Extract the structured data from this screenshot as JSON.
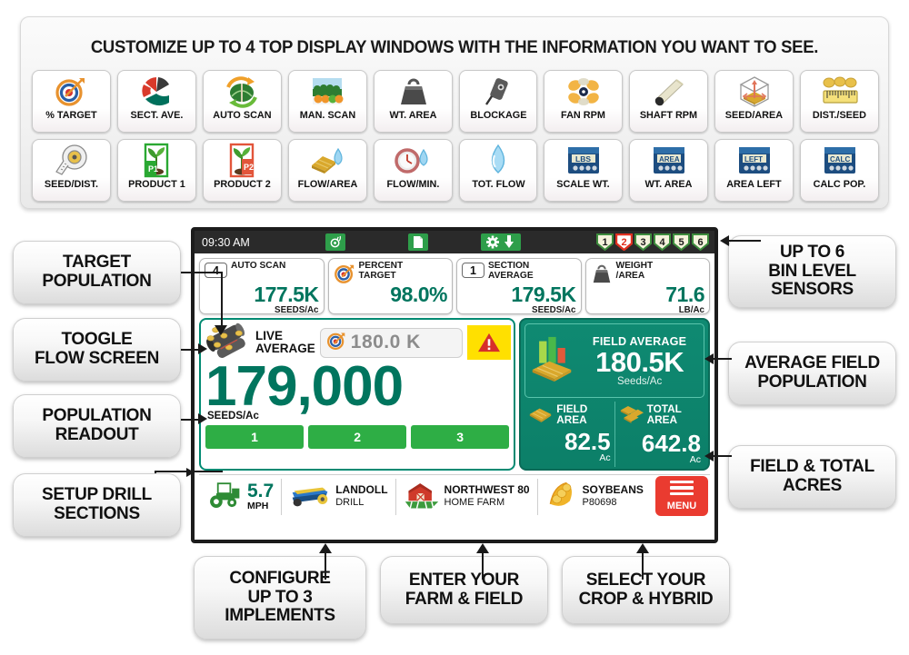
{
  "banner": {
    "title": "CUSTOMIZE UP TO 4 TOP DISPLAY WINDOWS WITH THE INFORMATION YOU WANT TO SEE."
  },
  "icon_grid": {
    "row1": [
      {
        "label": "% TARGET",
        "icon": "target-icon"
      },
      {
        "label": "SECT. AVE.",
        "icon": "pie-segments-icon"
      },
      {
        "label": "AUTO SCAN",
        "icon": "field-refresh-icon"
      },
      {
        "label": "MAN. SCAN",
        "icon": "field-rows-icon"
      },
      {
        "label": "WT. AREA",
        "icon": "weight-icon"
      },
      {
        "label": "BLOCKAGE",
        "icon": "sensor-icon"
      },
      {
        "label": "FAN RPM",
        "icon": "fan-icon"
      },
      {
        "label": "SHAFT RPM",
        "icon": "shaft-icon"
      },
      {
        "label": "SEED/AREA",
        "icon": "seed-area-cube-icon"
      },
      {
        "label": "DIST./SEED",
        "icon": "ruler-seeds-icon"
      }
    ],
    "row2": [
      {
        "label": "SEED/DIST.",
        "icon": "tape-measure-icon"
      },
      {
        "label": "PRODUCT 1",
        "icon": "plant-p1-icon"
      },
      {
        "label": "PRODUCT 2",
        "icon": "plant-p2-icon"
      },
      {
        "label": "FLOW/AREA",
        "icon": "field-droplet-icon"
      },
      {
        "label": "FLOW/MIN.",
        "icon": "gauge-droplet-icon"
      },
      {
        "label": "TOT. FLOW",
        "icon": "droplet-icon"
      },
      {
        "label": "SCALE WT.",
        "icon": "screen-lbs-icon"
      },
      {
        "label": "WT. AREA",
        "icon": "screen-area-icon"
      },
      {
        "label": "AREA LEFT",
        "icon": "screen-left-icon"
      },
      {
        "label": "CALC POP.",
        "icon": "screen-calc-icon"
      }
    ]
  },
  "monitor": {
    "statusbar": {
      "clock": "09:30 AM",
      "icons": [
        "gps-signal-icon",
        "file-icon",
        "gear-icon",
        "download-arrow-icon"
      ],
      "bins": [
        {
          "number": "1",
          "state": "ok"
        },
        {
          "number": "2",
          "state": "alarm"
        },
        {
          "number": "3",
          "state": "ok"
        },
        {
          "number": "4",
          "state": "ok"
        },
        {
          "number": "5",
          "state": "ok"
        },
        {
          "number": "6",
          "state": "ok"
        }
      ]
    },
    "windows": [
      {
        "badge": "4",
        "title": "AUTO SCAN",
        "icon": "",
        "value": "177.5K",
        "unit": "SEEDS/Ac"
      },
      {
        "badge": "",
        "title": "PERCENT\nTARGET",
        "icon": "target-icon",
        "value": "98.0%",
        "unit": ""
      },
      {
        "badge": "1",
        "title": "SECTION\nAVERAGE",
        "icon": "",
        "value": "179.5K",
        "unit": "SEEDS/Ac"
      },
      {
        "badge": "",
        "title": "WEIGHT\n/AREA",
        "icon": "weight-icon",
        "value": "71.6",
        "unit": "LB/Ac"
      }
    ],
    "live": {
      "label_line1": "LIVE",
      "label_line2": "AVERAGE",
      "icon": "seed-meter-icon",
      "target_icon": "target-icon",
      "target_value": "180.0 K",
      "warning_icon": "warning-triangle-icon",
      "population": "179,000",
      "population_unit": "SEEDS/Ac",
      "sections": [
        "1",
        "2",
        "3"
      ]
    },
    "field_panel": {
      "chart_icon": "bar-chart-field-icon",
      "avg_title": "FIELD AVERAGE",
      "avg_value": "180.5K",
      "avg_unit": "Seeds/Ac",
      "field_area": {
        "icon": "field-plot-icon",
        "title": "FIELD\nAREA",
        "value": "82.5",
        "unit": "Ac"
      },
      "total_area": {
        "icon": "field-plots-icon",
        "title": "TOTAL\nAREA",
        "value": "642.8",
        "unit": "Ac"
      }
    },
    "bottombar": {
      "speed_icon": "tractor-icon",
      "speed_value": "5.7",
      "speed_unit": "MPH",
      "implement_icon": "drill-icon",
      "implement_name": "LANDOLL",
      "implement_type": "DRILL",
      "farm_icon": "barn-field-icon",
      "field_name": "NORTHWEST 80",
      "farm_name": "HOME FARM",
      "crop_icon": "soybean-pod-icon",
      "crop_name": "SOYBEANS",
      "crop_hybrid": "P80698",
      "menu_icon": "hamburger-icon",
      "menu_label": "MENU"
    }
  },
  "callouts": {
    "target_population": "TARGET\nPOPULATION",
    "toggle_flow_screen": "TOOGLE\nFLOW SCREEN",
    "population_readout": "POPULATION\nREADOUT",
    "setup_drill_sections": "SETUP DRILL\nSECTIONS",
    "bin_level_sensors": "UP TO 6\nBIN LEVEL\nSENSORS",
    "average_field_population": "AVERAGE FIELD\nPOPULATION",
    "field_total_acres": "FIELD & TOTAL\nACRES",
    "configure_implements": "CONFIGURE\nUP TO 3\nIMPLEMENTS",
    "enter_farm_field": "ENTER YOUR\nFARM & FIELD",
    "select_crop_hybrid": "SELECT YOUR\nCROP & HYBRID"
  },
  "colors": {
    "teal": "#00755e",
    "panel_green": "#0c7f68",
    "section_green": "#2eae45",
    "menu_red": "#ea3b30",
    "warn_yellow": "#ffe000",
    "statusbar": "#2a2a2a"
  }
}
